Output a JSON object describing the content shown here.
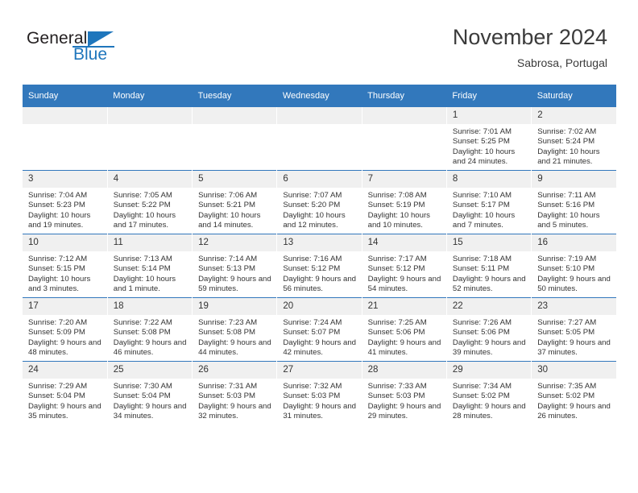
{
  "brand": {
    "word_one": "General",
    "word_two": "Blue",
    "flag_icon": "blue-triangle-flag-icon",
    "accent_color": "#1f76bc"
  },
  "header": {
    "month_title": "November 2024",
    "location": "Sabrosa, Portugal"
  },
  "theme": {
    "header_row_color": "#3278bc",
    "daynum_band_color": "#f0f0f0",
    "text_color": "#333333"
  },
  "calendar": {
    "weekday_headers": [
      "Sunday",
      "Monday",
      "Tuesday",
      "Wednesday",
      "Thursday",
      "Friday",
      "Saturday"
    ],
    "weeks": [
      [
        {
          "day": "",
          "empty": true,
          "sunrise": "",
          "sunset": "",
          "daylight": ""
        },
        {
          "day": "",
          "empty": true,
          "sunrise": "",
          "sunset": "",
          "daylight": ""
        },
        {
          "day": "",
          "empty": true,
          "sunrise": "",
          "sunset": "",
          "daylight": ""
        },
        {
          "day": "",
          "empty": true,
          "sunrise": "",
          "sunset": "",
          "daylight": ""
        },
        {
          "day": "",
          "empty": true,
          "sunrise": "",
          "sunset": "",
          "daylight": ""
        },
        {
          "day": "1",
          "sunrise": "Sunrise: 7:01 AM",
          "sunset": "Sunset: 5:25 PM",
          "daylight": "Daylight: 10 hours and 24 minutes."
        },
        {
          "day": "2",
          "sunrise": "Sunrise: 7:02 AM",
          "sunset": "Sunset: 5:24 PM",
          "daylight": "Daylight: 10 hours and 21 minutes."
        }
      ],
      [
        {
          "day": "3",
          "sunrise": "Sunrise: 7:04 AM",
          "sunset": "Sunset: 5:23 PM",
          "daylight": "Daylight: 10 hours and 19 minutes."
        },
        {
          "day": "4",
          "sunrise": "Sunrise: 7:05 AM",
          "sunset": "Sunset: 5:22 PM",
          "daylight": "Daylight: 10 hours and 17 minutes."
        },
        {
          "day": "5",
          "sunrise": "Sunrise: 7:06 AM",
          "sunset": "Sunset: 5:21 PM",
          "daylight": "Daylight: 10 hours and 14 minutes."
        },
        {
          "day": "6",
          "sunrise": "Sunrise: 7:07 AM",
          "sunset": "Sunset: 5:20 PM",
          "daylight": "Daylight: 10 hours and 12 minutes."
        },
        {
          "day": "7",
          "sunrise": "Sunrise: 7:08 AM",
          "sunset": "Sunset: 5:19 PM",
          "daylight": "Daylight: 10 hours and 10 minutes."
        },
        {
          "day": "8",
          "sunrise": "Sunrise: 7:10 AM",
          "sunset": "Sunset: 5:17 PM",
          "daylight": "Daylight: 10 hours and 7 minutes."
        },
        {
          "day": "9",
          "sunrise": "Sunrise: 7:11 AM",
          "sunset": "Sunset: 5:16 PM",
          "daylight": "Daylight: 10 hours and 5 minutes."
        }
      ],
      [
        {
          "day": "10",
          "sunrise": "Sunrise: 7:12 AM",
          "sunset": "Sunset: 5:15 PM",
          "daylight": "Daylight: 10 hours and 3 minutes."
        },
        {
          "day": "11",
          "sunrise": "Sunrise: 7:13 AM",
          "sunset": "Sunset: 5:14 PM",
          "daylight": "Daylight: 10 hours and 1 minute."
        },
        {
          "day": "12",
          "sunrise": "Sunrise: 7:14 AM",
          "sunset": "Sunset: 5:13 PM",
          "daylight": "Daylight: 9 hours and 59 minutes."
        },
        {
          "day": "13",
          "sunrise": "Sunrise: 7:16 AM",
          "sunset": "Sunset: 5:12 PM",
          "daylight": "Daylight: 9 hours and 56 minutes."
        },
        {
          "day": "14",
          "sunrise": "Sunrise: 7:17 AM",
          "sunset": "Sunset: 5:12 PM",
          "daylight": "Daylight: 9 hours and 54 minutes."
        },
        {
          "day": "15",
          "sunrise": "Sunrise: 7:18 AM",
          "sunset": "Sunset: 5:11 PM",
          "daylight": "Daylight: 9 hours and 52 minutes."
        },
        {
          "day": "16",
          "sunrise": "Sunrise: 7:19 AM",
          "sunset": "Sunset: 5:10 PM",
          "daylight": "Daylight: 9 hours and 50 minutes."
        }
      ],
      [
        {
          "day": "17",
          "sunrise": "Sunrise: 7:20 AM",
          "sunset": "Sunset: 5:09 PM",
          "daylight": "Daylight: 9 hours and 48 minutes."
        },
        {
          "day": "18",
          "sunrise": "Sunrise: 7:22 AM",
          "sunset": "Sunset: 5:08 PM",
          "daylight": "Daylight: 9 hours and 46 minutes."
        },
        {
          "day": "19",
          "sunrise": "Sunrise: 7:23 AM",
          "sunset": "Sunset: 5:08 PM",
          "daylight": "Daylight: 9 hours and 44 minutes."
        },
        {
          "day": "20",
          "sunrise": "Sunrise: 7:24 AM",
          "sunset": "Sunset: 5:07 PM",
          "daylight": "Daylight: 9 hours and 42 minutes."
        },
        {
          "day": "21",
          "sunrise": "Sunrise: 7:25 AM",
          "sunset": "Sunset: 5:06 PM",
          "daylight": "Daylight: 9 hours and 41 minutes."
        },
        {
          "day": "22",
          "sunrise": "Sunrise: 7:26 AM",
          "sunset": "Sunset: 5:06 PM",
          "daylight": "Daylight: 9 hours and 39 minutes."
        },
        {
          "day": "23",
          "sunrise": "Sunrise: 7:27 AM",
          "sunset": "Sunset: 5:05 PM",
          "daylight": "Daylight: 9 hours and 37 minutes."
        }
      ],
      [
        {
          "day": "24",
          "sunrise": "Sunrise: 7:29 AM",
          "sunset": "Sunset: 5:04 PM",
          "daylight": "Daylight: 9 hours and 35 minutes."
        },
        {
          "day": "25",
          "sunrise": "Sunrise: 7:30 AM",
          "sunset": "Sunset: 5:04 PM",
          "daylight": "Daylight: 9 hours and 34 minutes."
        },
        {
          "day": "26",
          "sunrise": "Sunrise: 7:31 AM",
          "sunset": "Sunset: 5:03 PM",
          "daylight": "Daylight: 9 hours and 32 minutes."
        },
        {
          "day": "27",
          "sunrise": "Sunrise: 7:32 AM",
          "sunset": "Sunset: 5:03 PM",
          "daylight": "Daylight: 9 hours and 31 minutes."
        },
        {
          "day": "28",
          "sunrise": "Sunrise: 7:33 AM",
          "sunset": "Sunset: 5:03 PM",
          "daylight": "Daylight: 9 hours and 29 minutes."
        },
        {
          "day": "29",
          "sunrise": "Sunrise: 7:34 AM",
          "sunset": "Sunset: 5:02 PM",
          "daylight": "Daylight: 9 hours and 28 minutes."
        },
        {
          "day": "30",
          "sunrise": "Sunrise: 7:35 AM",
          "sunset": "Sunset: 5:02 PM",
          "daylight": "Daylight: 9 hours and 26 minutes."
        }
      ]
    ]
  }
}
